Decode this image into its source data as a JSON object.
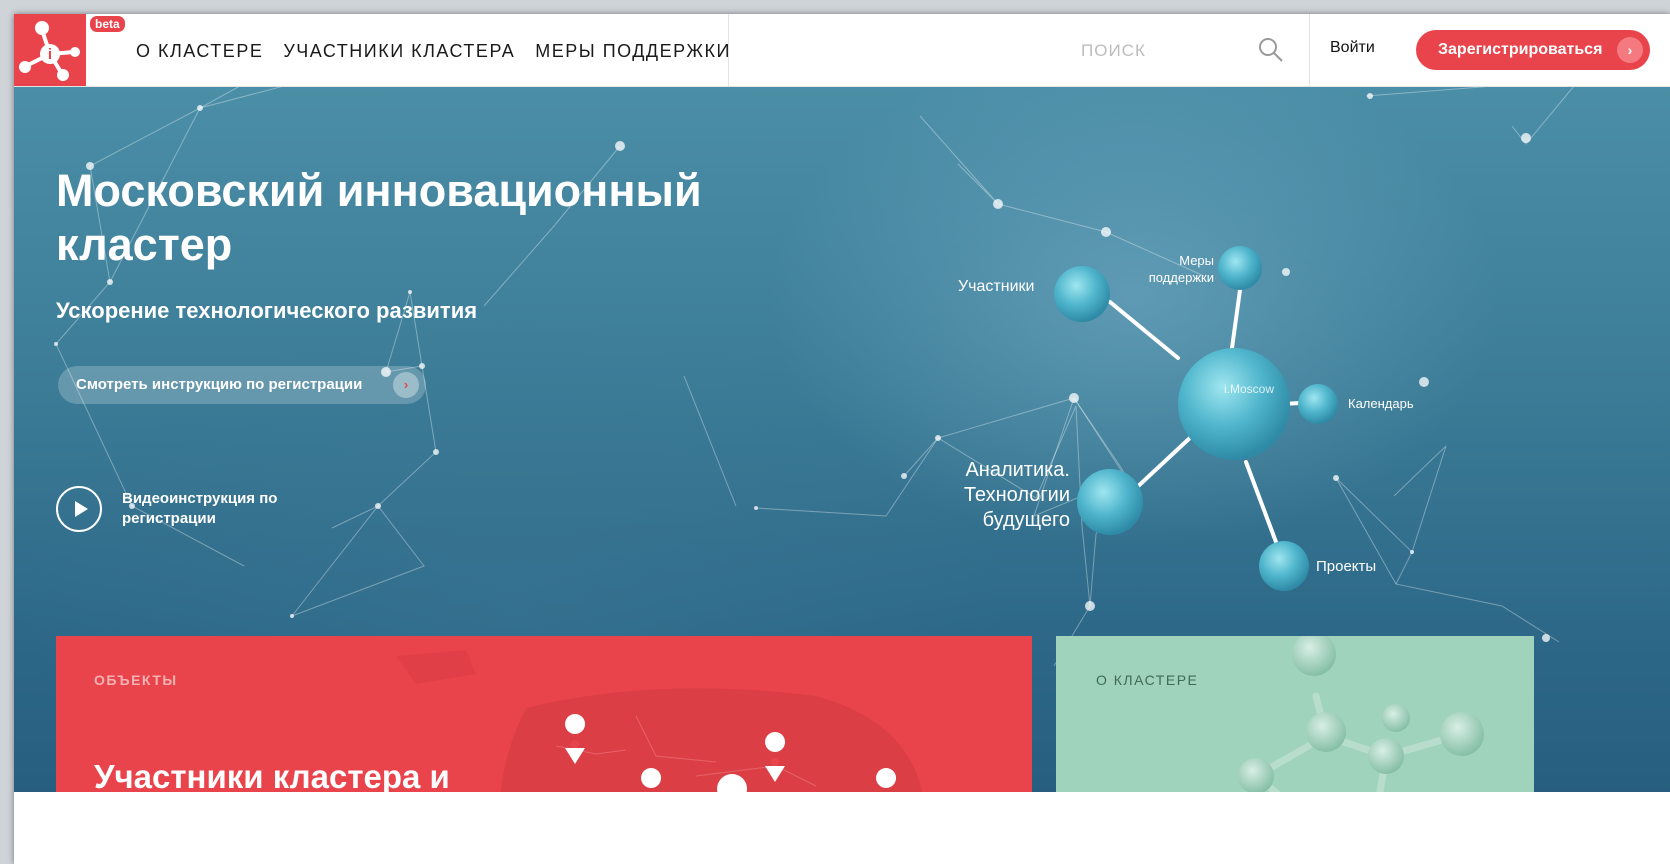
{
  "header": {
    "logo_icon": "molecule-i-logo-icon",
    "beta_badge": "beta",
    "nav": [
      {
        "label": "О КЛАСТЕРЕ"
      },
      {
        "label": "УЧАСТНИКИ КЛАСТЕРА"
      },
      {
        "label": "МЕРЫ ПОДДЕРЖКИ"
      }
    ],
    "search_placeholder": "ПОИСК",
    "search_icon": "search-icon",
    "login_label": "Войти",
    "register_label": "Зарегистрироваться",
    "register_arrow": "›"
  },
  "hero": {
    "title": "Московский инновационный кластер",
    "subtitle": "Ускорение технологического развития",
    "instruction_button": "Смотреть инструкцию по регистрации",
    "instruction_arrow": "›",
    "video_label": "Видеоинструкция по регистрации",
    "graph": {
      "participants": "Участники",
      "support": "Меры поддержки",
      "center": "i.Moscow",
      "calendar": "Календарь",
      "analytics": "Аналитика. Технологии будущего",
      "projects": "Проекты"
    }
  },
  "cards": {
    "objects_kicker": "ОБЪЕКТЫ",
    "objects_title": "Участники кластера и инновационная",
    "about_kicker": "О КЛАСТЕРЕ"
  },
  "colors": {
    "brand_red": "#e9444b",
    "hero_blue": "#3b7b96",
    "card_green": "#9fd3bb"
  }
}
